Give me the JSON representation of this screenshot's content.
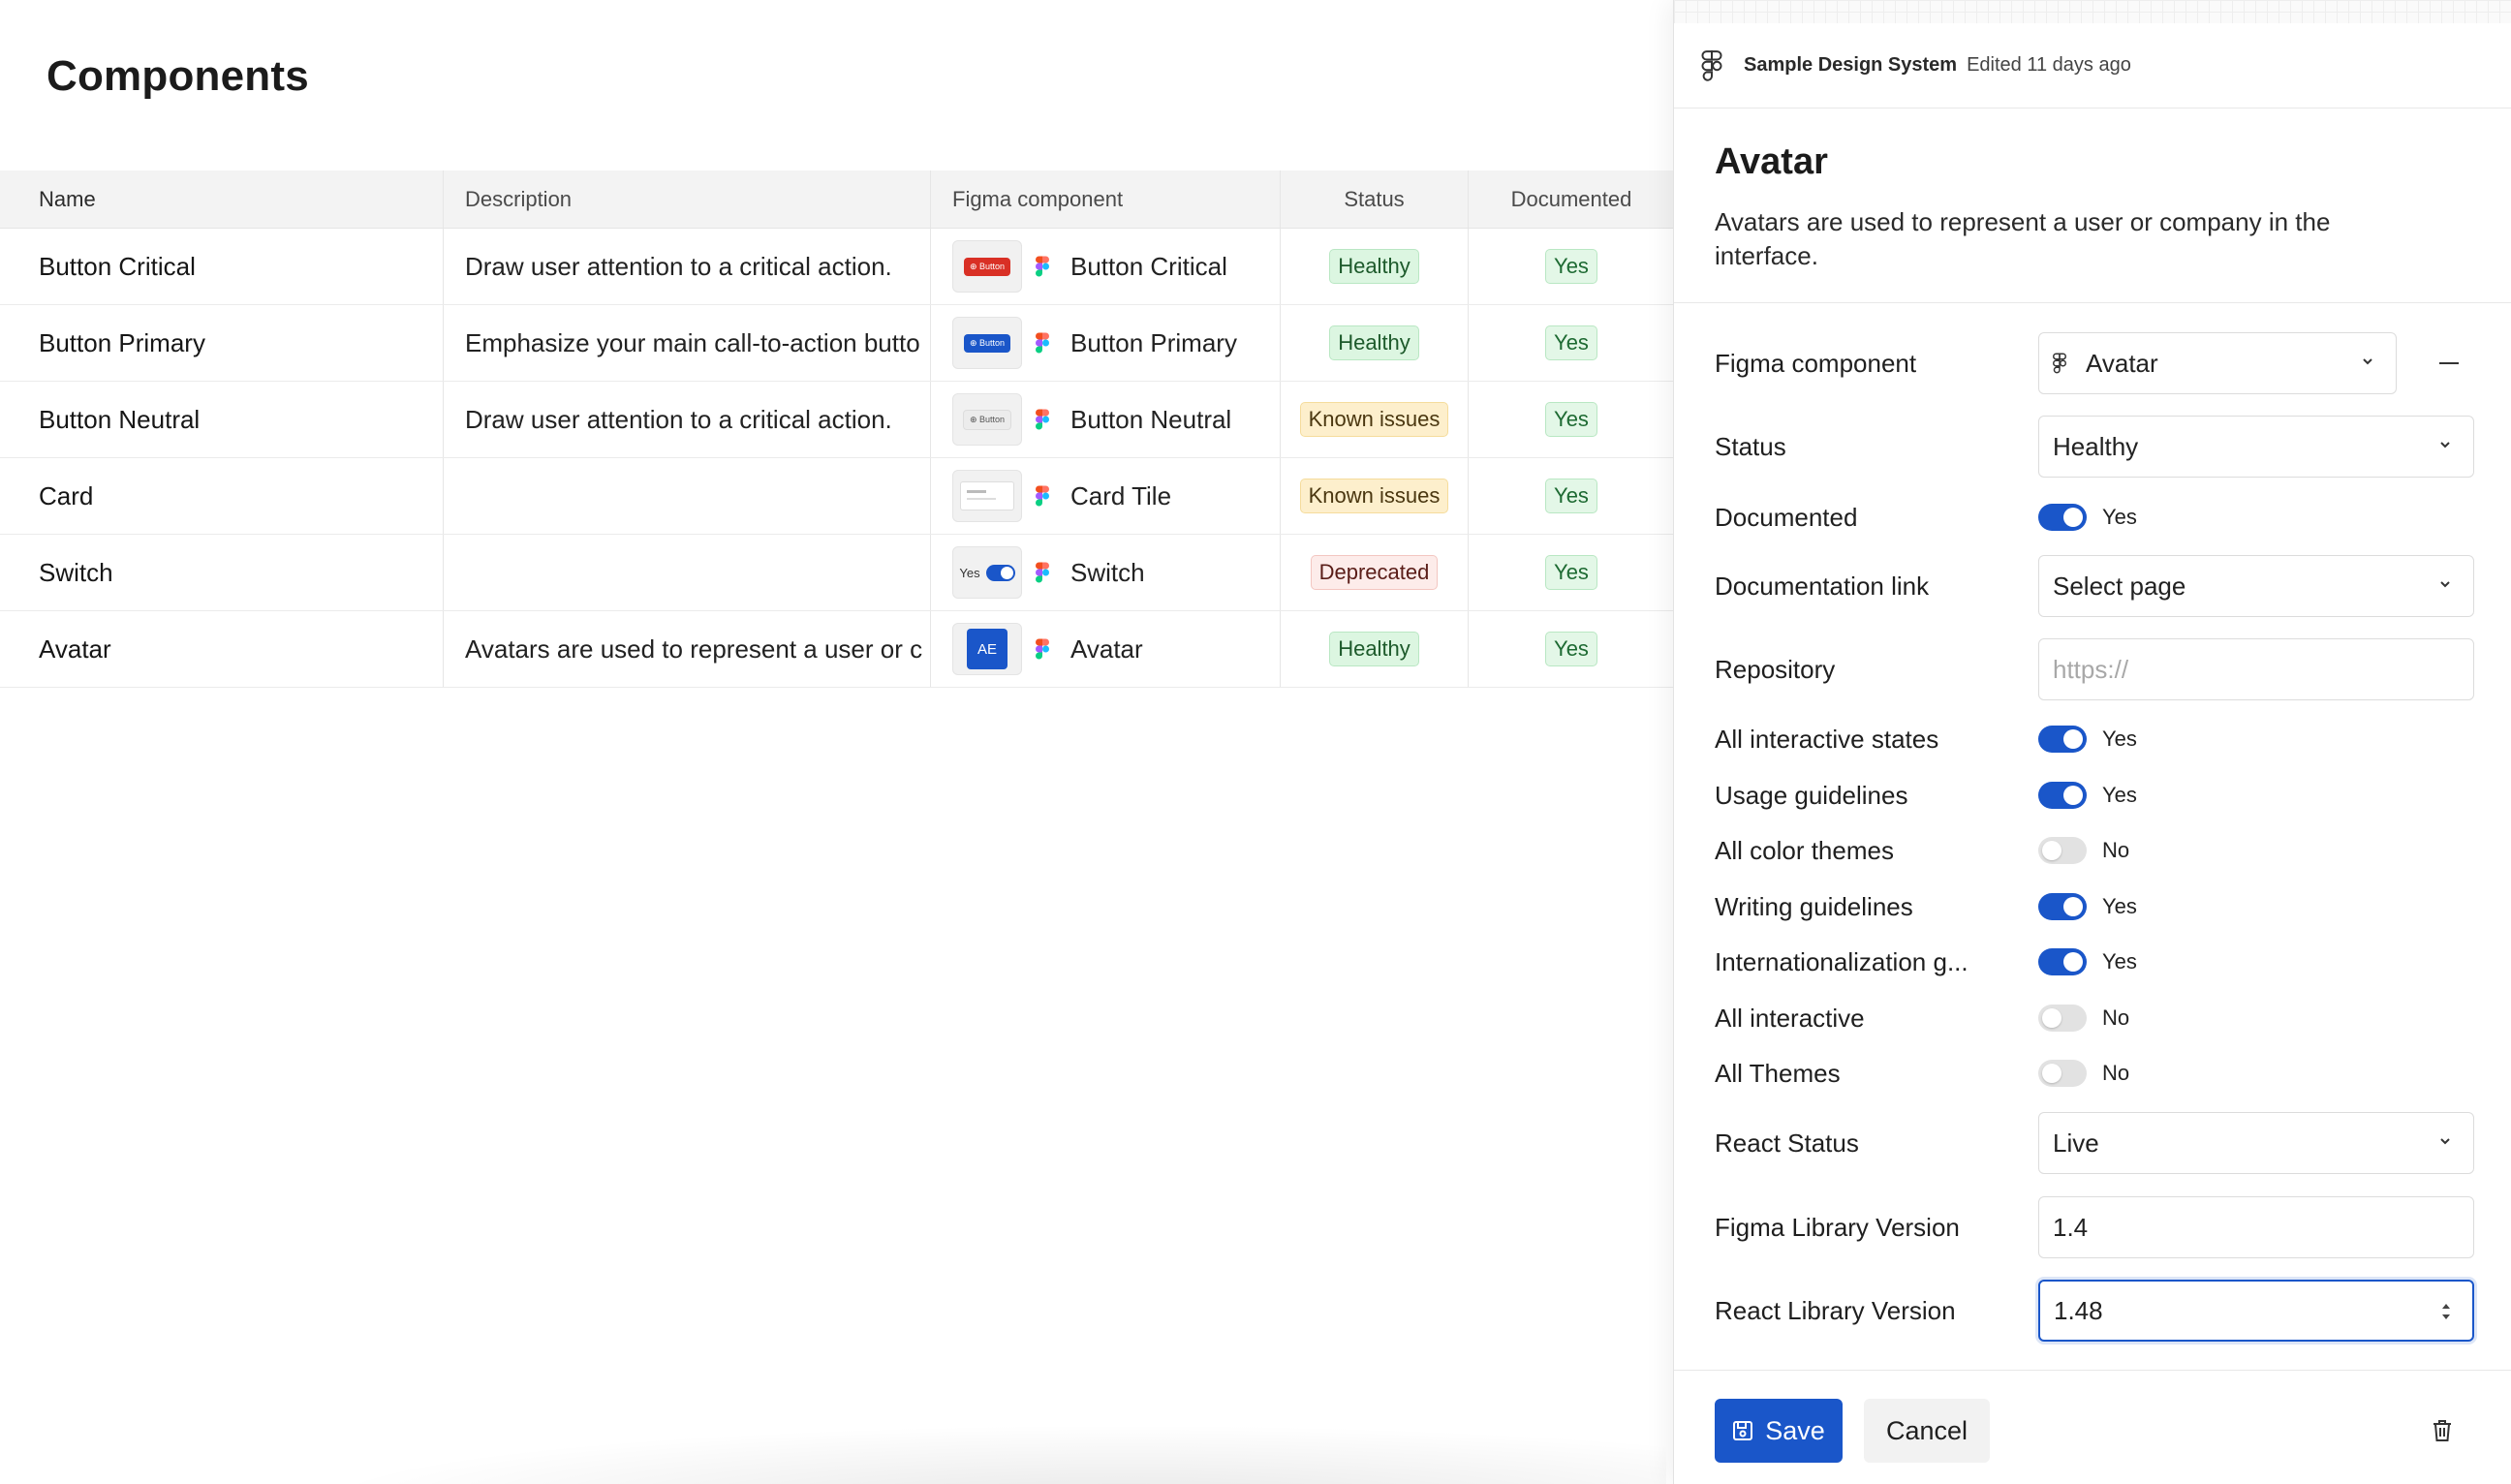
{
  "page": {
    "title": "Components"
  },
  "table": {
    "headers": {
      "name": "Name",
      "description": "Description",
      "figma_component": "Figma component",
      "status": "Status",
      "documented": "Documented"
    },
    "rows": [
      {
        "name": "Button Critical",
        "description": "Draw user attention to a critical action.",
        "thumb": "Button",
        "thumb_style": "critical",
        "figma": "Button Critical",
        "status": "Healthy",
        "status_type": "healthy",
        "documented": "Yes"
      },
      {
        "name": "Button Primary",
        "description": "Emphasize your main call-to-action butto",
        "thumb": "Button",
        "thumb_style": "primary",
        "figma": "Button Primary",
        "status": "Healthy",
        "status_type": "healthy",
        "documented": "Yes"
      },
      {
        "name": "Button Neutral",
        "description": "Draw user attention to a critical action.",
        "thumb": "Button",
        "thumb_style": "neutral",
        "figma": "Button Neutral",
        "status": "Known issues",
        "status_type": "known",
        "documented": "Yes"
      },
      {
        "name": "Card",
        "description": "",
        "thumb": "",
        "thumb_style": "card",
        "figma": "Card Tile",
        "status": "Known issues",
        "status_type": "known",
        "documented": "Yes"
      },
      {
        "name": "Switch",
        "description": "",
        "thumb": "Yes",
        "thumb_style": "switch",
        "figma": "Switch",
        "status": "Deprecated",
        "status_type": "deprecated",
        "documented": "Yes"
      },
      {
        "name": "Avatar",
        "description": "Avatars are used to represent a user or c",
        "thumb": "AE",
        "thumb_style": "avatar",
        "figma": "Avatar",
        "status": "Healthy",
        "status_type": "healthy",
        "documented": "Yes"
      }
    ]
  },
  "panel": {
    "header_title": "Sample Design System",
    "header_edited": "Edited 11 days ago",
    "title": "Avatar",
    "description": "Avatars are used to represent a user or company in the interface.",
    "fields": {
      "figma_component": {
        "label": "Figma component",
        "value": "Avatar"
      },
      "status": {
        "label": "Status",
        "value": "Healthy"
      },
      "documented": {
        "label": "Documented",
        "value": "Yes",
        "on": true
      },
      "documentation_link": {
        "label": "Documentation link",
        "value": "Select page"
      },
      "repository": {
        "label": "Repository",
        "placeholder": "https://"
      },
      "all_interactive_states": {
        "label": "All interactive states",
        "value": "Yes",
        "on": true
      },
      "usage_guidelines": {
        "label": "Usage guidelines",
        "value": "Yes",
        "on": true
      },
      "all_color_themes": {
        "label": "All color themes",
        "value": "No",
        "on": false
      },
      "writing_guidelines": {
        "label": "Writing guidelines",
        "value": "Yes",
        "on": true
      },
      "internationalization": {
        "label": "Internationalization g...",
        "value": "Yes",
        "on": true
      },
      "all_interactive": {
        "label": "All interactive",
        "value": "No",
        "on": false
      },
      "all_themes": {
        "label": "All Themes",
        "value": "No",
        "on": false
      },
      "react_status": {
        "label": "React Status",
        "value": "Live"
      },
      "figma_library_version": {
        "label": "Figma Library Version",
        "value": "1.4"
      },
      "react_library_version": {
        "label": "React Library Version",
        "value": "1.48"
      }
    },
    "save_label": "Save",
    "cancel_label": "Cancel"
  },
  "colors": {
    "accent": "#1a56c9",
    "healthy_bg": "#dcf6e1",
    "known_bg": "#fdefcc",
    "deprecated_bg": "#fdecea",
    "critical": "#d93025"
  },
  "icons": [
    "figma-icon",
    "chevron-down-icon",
    "minus-icon",
    "stepper-icon",
    "save-icon",
    "trash-icon"
  ]
}
